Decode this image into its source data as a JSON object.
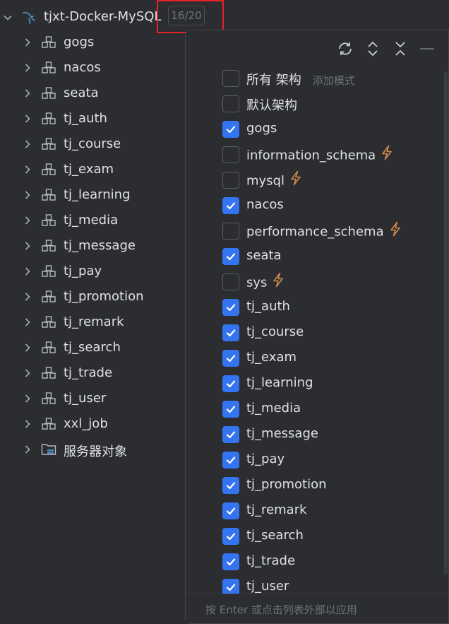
{
  "root": {
    "title": "tjxt-Docker-MySQL",
    "count_badge": "16/20"
  },
  "tree": [
    {
      "label": "gogs",
      "icon": "schema-icon"
    },
    {
      "label": "nacos",
      "icon": "schema-icon"
    },
    {
      "label": "seata",
      "icon": "schema-icon"
    },
    {
      "label": "tj_auth",
      "icon": "schema-icon"
    },
    {
      "label": "tj_course",
      "icon": "schema-icon"
    },
    {
      "label": "tj_exam",
      "icon": "schema-icon"
    },
    {
      "label": "tj_learning",
      "icon": "schema-icon"
    },
    {
      "label": "tj_media",
      "icon": "schema-icon"
    },
    {
      "label": "tj_message",
      "icon": "schema-icon"
    },
    {
      "label": "tj_pay",
      "icon": "schema-icon"
    },
    {
      "label": "tj_promotion",
      "icon": "schema-icon"
    },
    {
      "label": "tj_remark",
      "icon": "schema-icon"
    },
    {
      "label": "tj_search",
      "icon": "schema-icon"
    },
    {
      "label": "tj_trade",
      "icon": "schema-icon"
    },
    {
      "label": "tj_user",
      "icon": "schema-icon"
    },
    {
      "label": "xxl_job",
      "icon": "schema-icon"
    },
    {
      "label": "服务器对象",
      "icon": "server-objects-icon"
    }
  ],
  "popup": {
    "toolbar": [
      "refresh-icon",
      "expand-all-icon",
      "collapse-all-icon",
      "minimize-icon"
    ],
    "options": [
      {
        "label": "所有 架构",
        "checked": false,
        "hint": "添加模式"
      },
      {
        "label": "默认架构",
        "checked": false
      },
      {
        "label": "gogs",
        "checked": true
      },
      {
        "label": "information_schema",
        "checked": false,
        "system": true
      },
      {
        "label": "mysql",
        "checked": false,
        "system": true
      },
      {
        "label": "nacos",
        "checked": true
      },
      {
        "label": "performance_schema",
        "checked": false,
        "system": true
      },
      {
        "label": "seata",
        "checked": true
      },
      {
        "label": "sys",
        "checked": false,
        "system": true
      },
      {
        "label": "tj_auth",
        "checked": true
      },
      {
        "label": "tj_course",
        "checked": true
      },
      {
        "label": "tj_exam",
        "checked": true
      },
      {
        "label": "tj_learning",
        "checked": true
      },
      {
        "label": "tj_media",
        "checked": true
      },
      {
        "label": "tj_message",
        "checked": true
      },
      {
        "label": "tj_pay",
        "checked": true
      },
      {
        "label": "tj_promotion",
        "checked": true
      },
      {
        "label": "tj_remark",
        "checked": true
      },
      {
        "label": "tj_search",
        "checked": true
      },
      {
        "label": "tj_trade",
        "checked": true
      },
      {
        "label": "tj_user",
        "checked": true
      }
    ],
    "footer": "按 Enter 或点击列表外部以应用"
  },
  "colors": {
    "accent": "#3574f0",
    "bolt": "#d08a4f",
    "highlight_box": "#e8202a",
    "mysql_icon": "#4b8bbe"
  }
}
